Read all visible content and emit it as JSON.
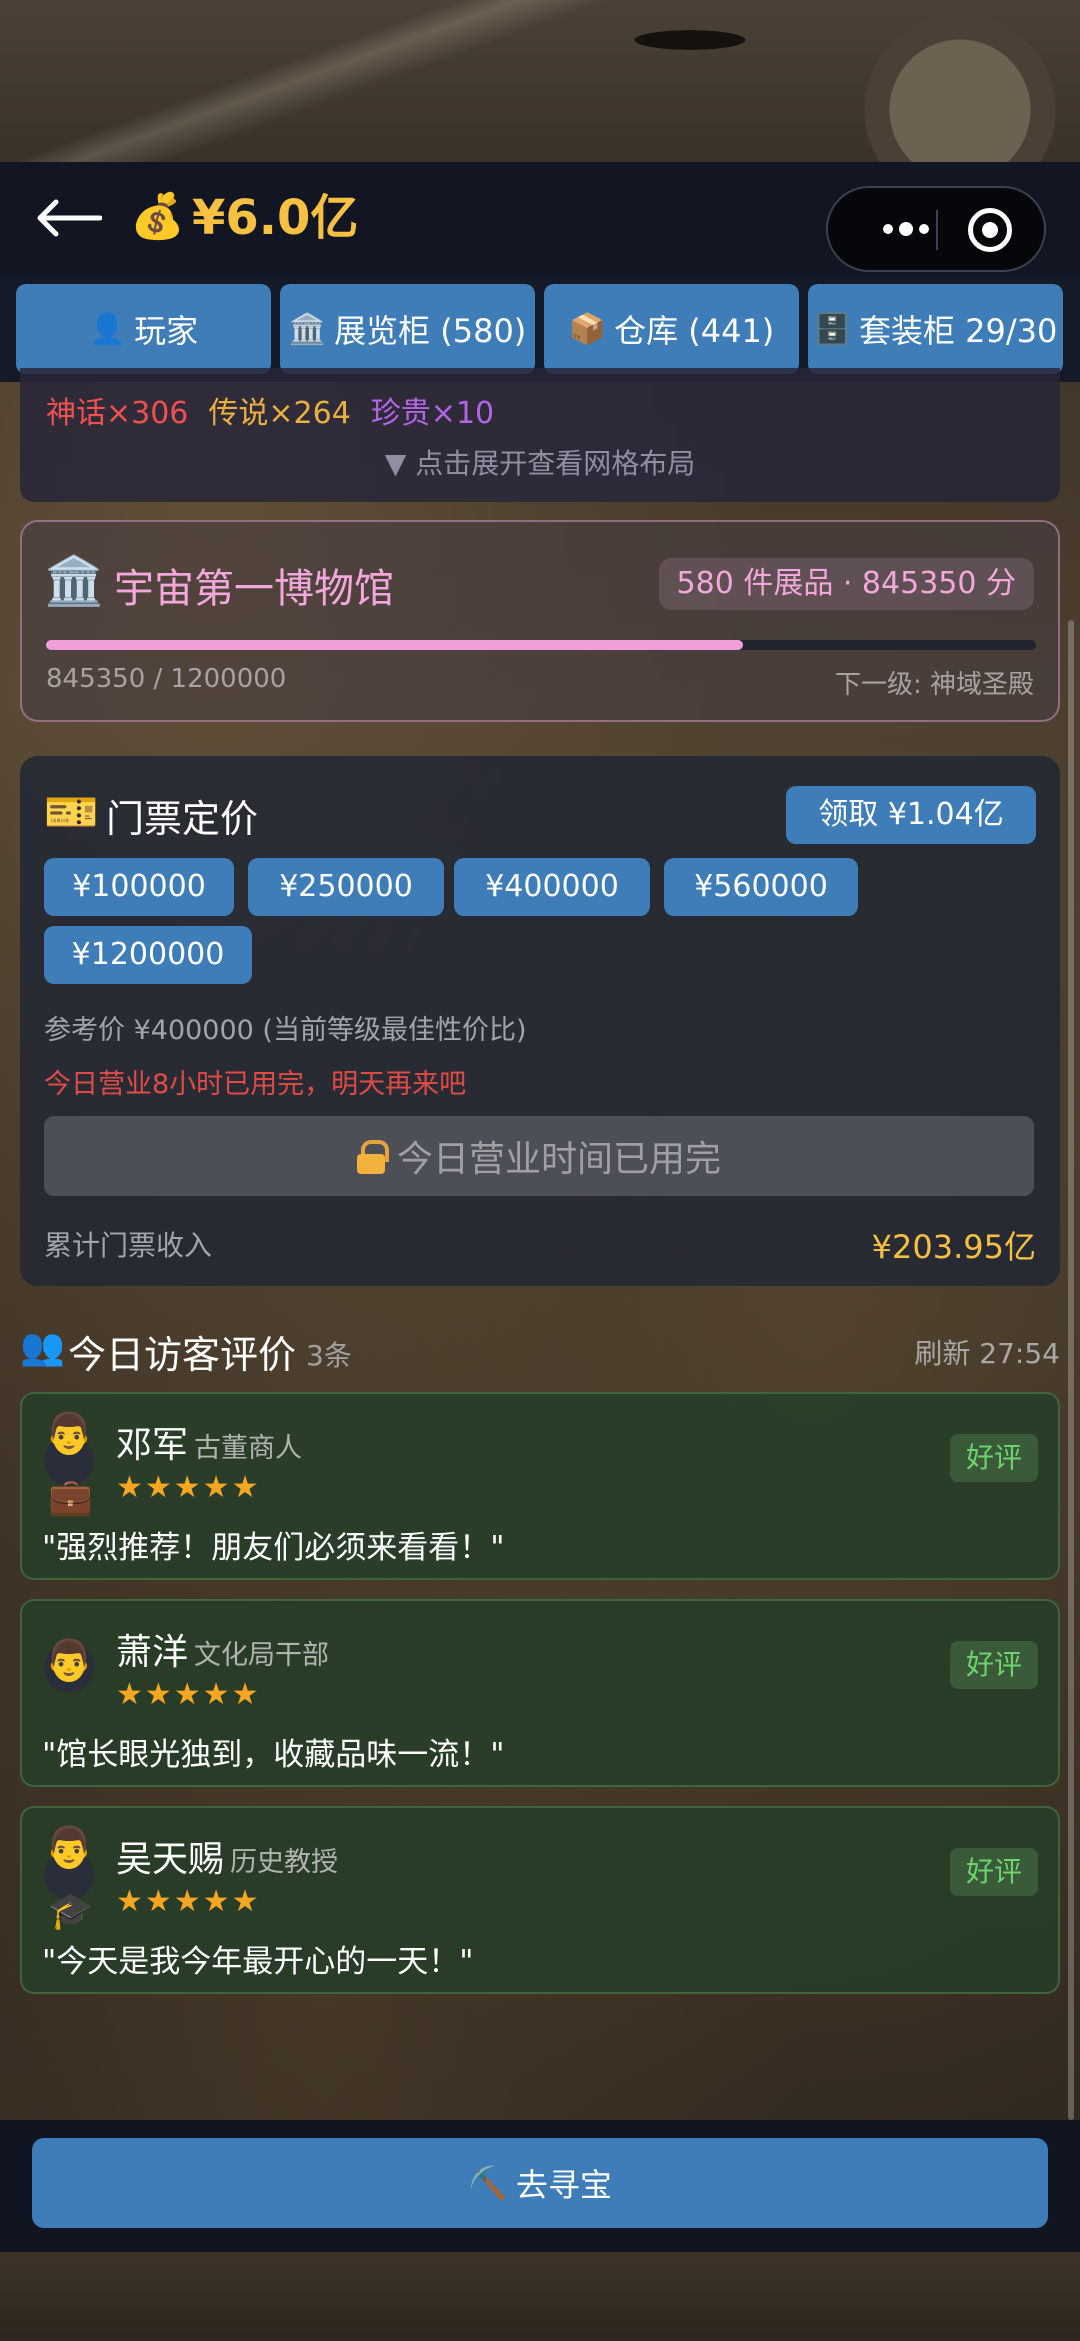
{
  "header": {
    "balance": "¥6.0亿"
  },
  "tabs": [
    {
      "icon": "👤",
      "label": "玩家"
    },
    {
      "icon": "🏛️",
      "label": "展览柜 (580)"
    },
    {
      "icon": "📦",
      "label": "仓库 (441)"
    },
    {
      "icon": "🗄️",
      "label": "套装柜 29/30"
    }
  ],
  "summary": {
    "myth": "神话×306",
    "legend": "传说×264",
    "rare": "珍贵×10",
    "expand_hint": "▼ 点击展开查看网格布局",
    "colors": {
      "myth": "#ef5151",
      "legend": "#e8b040",
      "rare": "#b265e6"
    }
  },
  "museum": {
    "title": "宇宙第一博物馆",
    "badge": "580 件展品 · 845350 分",
    "progress_text": "845350 / 1200000",
    "progress_fraction": 0.704,
    "next_level": "下一级: 神域圣殿",
    "accent": "#f29fd9"
  },
  "ticket": {
    "title": "门票定价",
    "claim_label": "领取 ¥1.04亿",
    "prices": [
      "¥100000",
      "¥250000",
      "¥400000",
      "¥560000",
      "¥1200000"
    ],
    "reference": "参考价 ¥400000 (当前等级最佳性价比)",
    "warning": "今日营业8小时已用完，明天再来吧",
    "closed_label": "今日营业时间已用完",
    "revenue_label": "累计门票收入",
    "revenue_value": "¥203.95亿"
  },
  "reviews": {
    "title": "今日访客评价",
    "count": "3条",
    "refresh": "刷新 27:54",
    "items": [
      {
        "name": "邓军",
        "role": "古董商人",
        "stars": "★★★★★",
        "badge": "好评",
        "text": "\"强烈推荐！朋友们必须来看看！\"",
        "face": "👨",
        "tool": "💼"
      },
      {
        "name": "萧洋",
        "role": "文化局干部",
        "stars": "★★★★★",
        "badge": "好评",
        "text": "\"馆长眼光独到，收藏品味一流！\"",
        "face": "👨",
        "tool": ""
      },
      {
        "name": "吴天赐",
        "role": "历史教授",
        "stars": "★★★★★",
        "badge": "好评",
        "text": "\"今天是我今年最开心的一天！\"",
        "face": "👨",
        "tool": "🎓"
      }
    ]
  },
  "bottom": {
    "icon": "⛏️",
    "label": "去寻宝"
  }
}
